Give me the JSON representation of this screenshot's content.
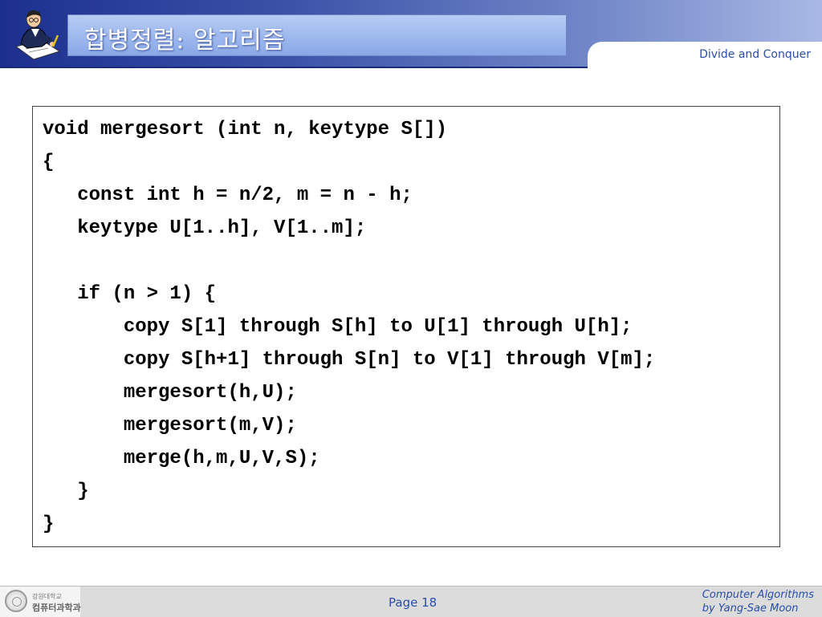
{
  "header": {
    "title": "합병정렬: 알고리즘",
    "subtitle": "Divide and Conquer",
    "logo_icon": "professor-writing-icon"
  },
  "code": {
    "lines": [
      "void mergesort (int n, keytype S[])",
      "{",
      "   const int h = n/2, m = n - h;",
      "   keytype U[1..h], V[1..m];",
      "",
      "   if (n > 1) {",
      "       copy S[1] through S[h] to U[1] through U[h];",
      "       copy S[h+1] through S[n] to V[1] through V[m];",
      "       mergesort(h,U);",
      "       mergesort(m,V);",
      "       merge(h,m,U,V,S);",
      "   }",
      "}"
    ]
  },
  "footer": {
    "university": "강원대학교",
    "department": "컴퓨터과학과",
    "page": "Page 18",
    "credit_line1": "Computer Algorithms",
    "credit_line2": "by Yang-Sae Moon",
    "seal_icon": "university-seal-icon"
  },
  "colors": {
    "header_dark": "#1c2f8e",
    "header_light": "#a9b8e4",
    "accent_text": "#2a4da6"
  }
}
